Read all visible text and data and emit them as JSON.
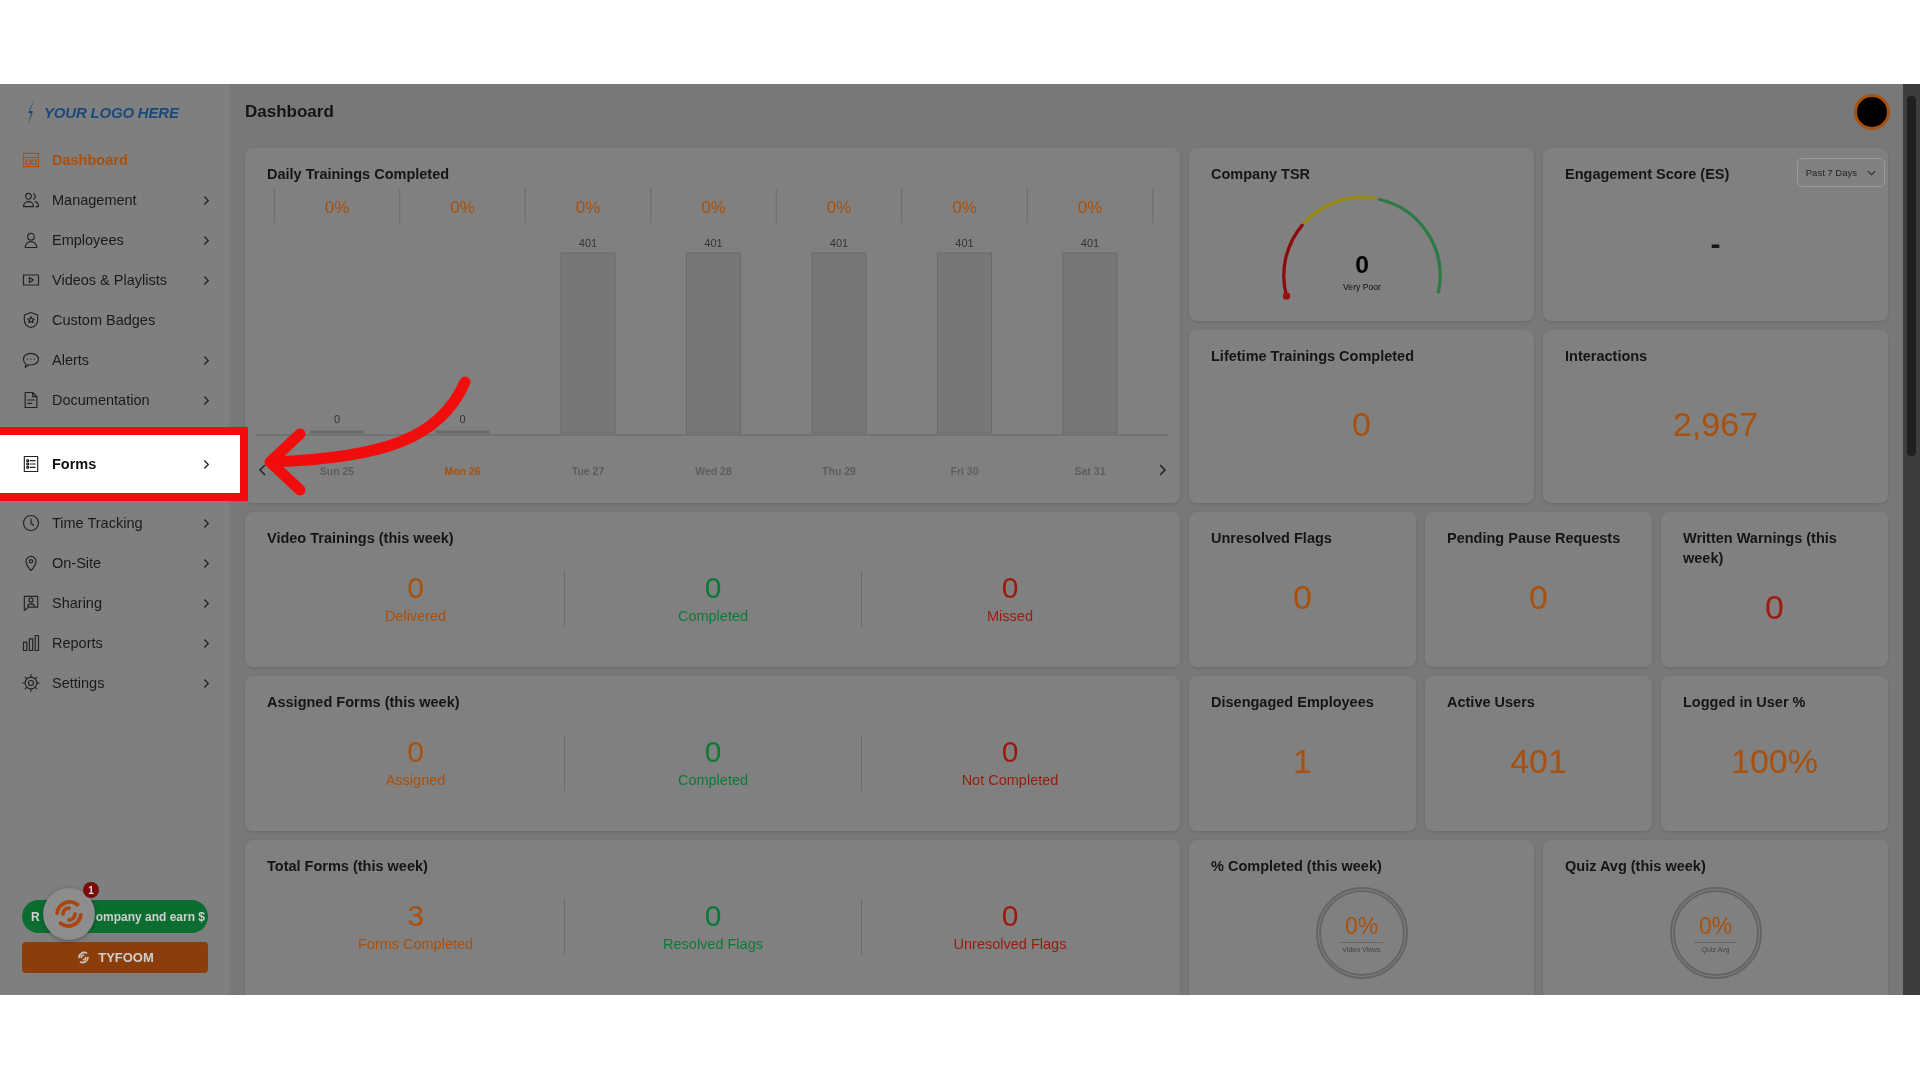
{
  "logo": {
    "text": "YOUR LOGO HERE"
  },
  "sidebar": {
    "items": [
      {
        "label": "Dashboard",
        "selected": true,
        "expandable": false,
        "highlighted": false
      },
      {
        "label": "Management",
        "selected": false,
        "expandable": true,
        "highlighted": false
      },
      {
        "label": "Employees",
        "selected": false,
        "expandable": true,
        "highlighted": false
      },
      {
        "label": "Videos & Playlists",
        "selected": false,
        "expandable": true,
        "highlighted": false
      },
      {
        "label": "Custom Badges",
        "selected": false,
        "expandable": false,
        "highlighted": false
      },
      {
        "label": "Alerts",
        "selected": false,
        "expandable": true,
        "highlighted": false
      },
      {
        "label": "Documentation",
        "selected": false,
        "expandable": true,
        "highlighted": false
      },
      {
        "label": "Forms",
        "selected": false,
        "expandable": true,
        "highlighted": true
      },
      {
        "label": "Time Tracking",
        "selected": false,
        "expandable": true,
        "highlighted": false
      },
      {
        "label": "On-Site",
        "selected": false,
        "expandable": true,
        "highlighted": false
      },
      {
        "label": "Sharing",
        "selected": false,
        "expandable": true,
        "highlighted": false
      },
      {
        "label": "Reports",
        "selected": false,
        "expandable": true,
        "highlighted": false
      },
      {
        "label": "Settings",
        "selected": false,
        "expandable": true,
        "highlighted": false
      }
    ]
  },
  "promo": {
    "lead": "R",
    "text": "ompany and earn $"
  },
  "chat_widget": {
    "badge": "1"
  },
  "brand_button": {
    "label": "TYFOOM"
  },
  "header": {
    "title": "Dashboard"
  },
  "daily_trainings": {
    "title": "Daily Trainings Completed",
    "percent_labels": [
      "0%",
      "0%",
      "0%",
      "0%",
      "0%",
      "0%",
      "0%"
    ],
    "day_states": [
      {
        "selected": false
      },
      {
        "selected": true
      },
      {
        "selected": false
      },
      {
        "selected": false
      },
      {
        "selected": false
      },
      {
        "selected": false
      },
      {
        "selected": false
      }
    ],
    "chart_data": {
      "type": "bar",
      "categories": [
        "Sun 25",
        "Mon 26",
        "Tue 27",
        "Wed 28",
        "Thu 29",
        "Fri 30",
        "Sat 31"
      ],
      "values": [
        0,
        0,
        401,
        401,
        401,
        401,
        401
      ],
      "data_labels": true
    }
  },
  "company_tsr": {
    "title": "Company TSR",
    "score": "0",
    "rating": "Very Poor"
  },
  "engagement": {
    "title": "Engagement Score (ES)",
    "period": "Past 7 Days",
    "value": "-"
  },
  "tiles": [
    {
      "title": "Lifetime Trainings Completed",
      "value": "0",
      "color": "#a9500c"
    },
    {
      "title": "Interactions",
      "value": "2,967",
      "color": "#a9500c"
    },
    {
      "title": "Unresolved Flags",
      "value": "0",
      "color": "#a9500c"
    },
    {
      "title": "Pending Pause Requests",
      "value": "0",
      "color": "#a9500c"
    },
    {
      "title": "Written Warnings (this week)",
      "value": "0",
      "color": "#9a1a0c"
    },
    {
      "title": "Disengaged Employees",
      "value": "1",
      "color": "#a9500c"
    },
    {
      "title": "Active Users",
      "value": "401",
      "color": "#a9500c"
    },
    {
      "title": "Logged in User %",
      "value": "100%",
      "color": "#a9500c"
    }
  ],
  "stat_groups": [
    {
      "title": "Video Trainings (this week)",
      "stats": [
        {
          "value": "0",
          "label": "Delivered",
          "color": "#a9500c"
        },
        {
          "value": "0",
          "label": "Completed",
          "color": "#0c7a36"
        },
        {
          "value": "0",
          "label": "Missed",
          "color": "#9a1a0c"
        }
      ]
    },
    {
      "title": "Assigned Forms (this week)",
      "stats": [
        {
          "value": "0",
          "label": "Assigned",
          "color": "#a9500c"
        },
        {
          "value": "0",
          "label": "Completed",
          "color": "#0c7a36"
        },
        {
          "value": "0",
          "label": "Not Completed",
          "color": "#9a1a0c"
        }
      ]
    },
    {
      "title": "Total Forms (this week)",
      "stats": [
        {
          "value": "3",
          "label": "Forms Completed",
          "color": "#a9500c"
        },
        {
          "value": "0",
          "label": "Resolved Flags",
          "color": "#0c7a36"
        },
        {
          "value": "0",
          "label": "Unresolved Flags",
          "color": "#9a1a0c"
        }
      ]
    }
  ],
  "rings": [
    {
      "title": "% Completed (this week)",
      "value": "0%",
      "caption": "Video Views"
    },
    {
      "title": "Quiz Avg (this week)",
      "value": "0%",
      "caption": "Quiz Avg"
    }
  ]
}
